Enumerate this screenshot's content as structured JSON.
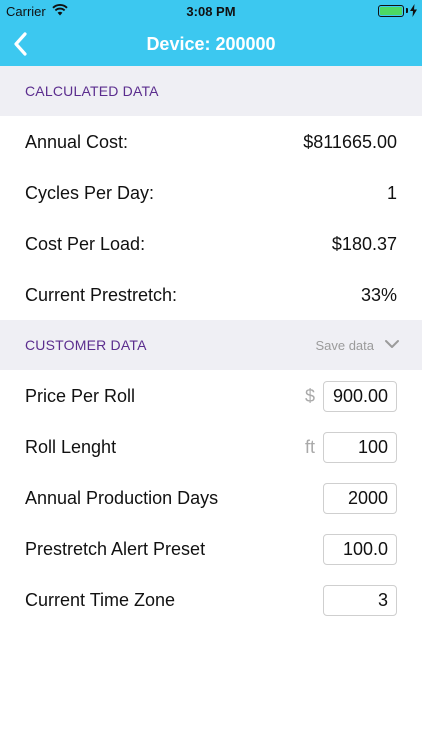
{
  "status_bar": {
    "carrier": "Carrier",
    "time": "3:08 PM",
    "battery_level": 1.0
  },
  "nav": {
    "title": "Device: 200000"
  },
  "calculated": {
    "header": "CALCULATED DATA",
    "rows": [
      {
        "label": "Annual Cost:",
        "value": "$811665.00"
      },
      {
        "label": "Cycles Per  Day:",
        "value": "1"
      },
      {
        "label": "Cost Per Load:",
        "value": "$180.37"
      },
      {
        "label": "Current Prestretch:",
        "value": "33%"
      }
    ]
  },
  "customer": {
    "header": "CUSTOMER DATA",
    "save_label": "Save data",
    "rows": [
      {
        "label": "Price Per Roll",
        "unit": "$",
        "value": "900.00"
      },
      {
        "label": "Roll Lenght",
        "unit": "ft",
        "value": "100"
      },
      {
        "label": "Annual Production Days",
        "value": "2000"
      },
      {
        "label": "Prestretch Alert Preset",
        "value": "100.0"
      },
      {
        "label": "Current Time Zone",
        "value": "3"
      }
    ]
  },
  "colors": {
    "accent": "#3cc8f0",
    "section_label": "#5b2d8e",
    "section_bg": "#efeff4"
  }
}
